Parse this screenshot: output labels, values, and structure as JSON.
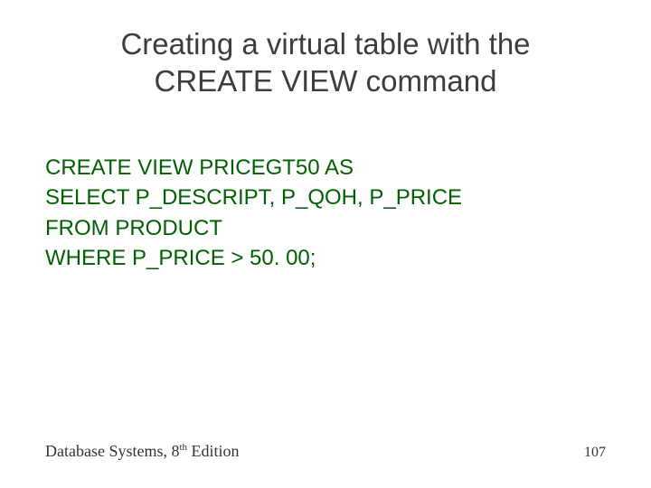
{
  "title": "Creating a virtual table with the CREATE VIEW command",
  "code": {
    "line1": "CREATE VIEW PRICEGT50 AS",
    "line2": "SELECT  P_DESCRIPT, P_QOH, P_PRICE",
    "line3": "FROM PRODUCT",
    "line4": "WHERE P_PRICE > 50. 00;"
  },
  "footer": {
    "book_prefix": "Database Systems, 8",
    "ordinal": "th",
    "book_suffix": " Edition",
    "page": "107"
  }
}
